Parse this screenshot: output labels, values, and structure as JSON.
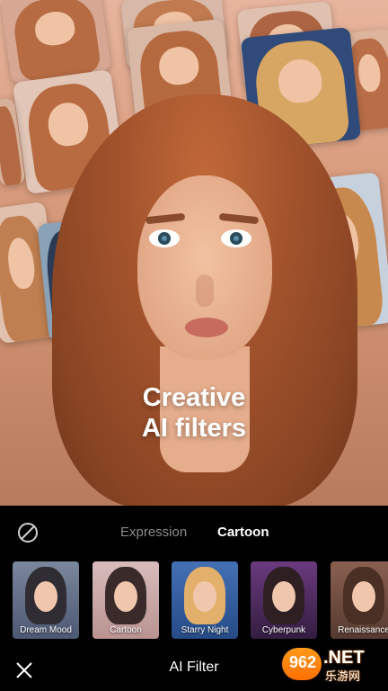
{
  "hero": {
    "headline_line1": "Creative",
    "headline_line2": "AI filters"
  },
  "tabs": [
    {
      "label": "Expression",
      "active": false
    },
    {
      "label": "Cartoon",
      "active": true
    }
  ],
  "filters": [
    {
      "label": "Dream Mood",
      "selected": false,
      "bg": "#5f6b85",
      "hair": "#2f2d33"
    },
    {
      "label": "Cartoon",
      "selected": true,
      "bg": "#caa7a4",
      "hair": "#3a2b2a"
    },
    {
      "label": "Starry Night",
      "selected": false,
      "bg": "#2f5fa3",
      "hair": "#e3b06b"
    },
    {
      "label": "Cyberpunk",
      "selected": false,
      "bg": "#4b2c5b",
      "hair": "#2e1f22"
    },
    {
      "label": "Renaissance",
      "selected": false,
      "bg": "#6f4a3e",
      "hair": "#4a2f24"
    }
  ],
  "bottom_bar": {
    "title": "AI Filter"
  },
  "watermark": {
    "number": "962",
    "suffix": ".NET",
    "chinese": "乐游网"
  },
  "colors": {
    "accent": "#e3475f",
    "inactive_tab": "#8b8b8b",
    "background": "#000000"
  },
  "icons": {
    "none_filter": "ban-icon",
    "close": "close-icon"
  }
}
